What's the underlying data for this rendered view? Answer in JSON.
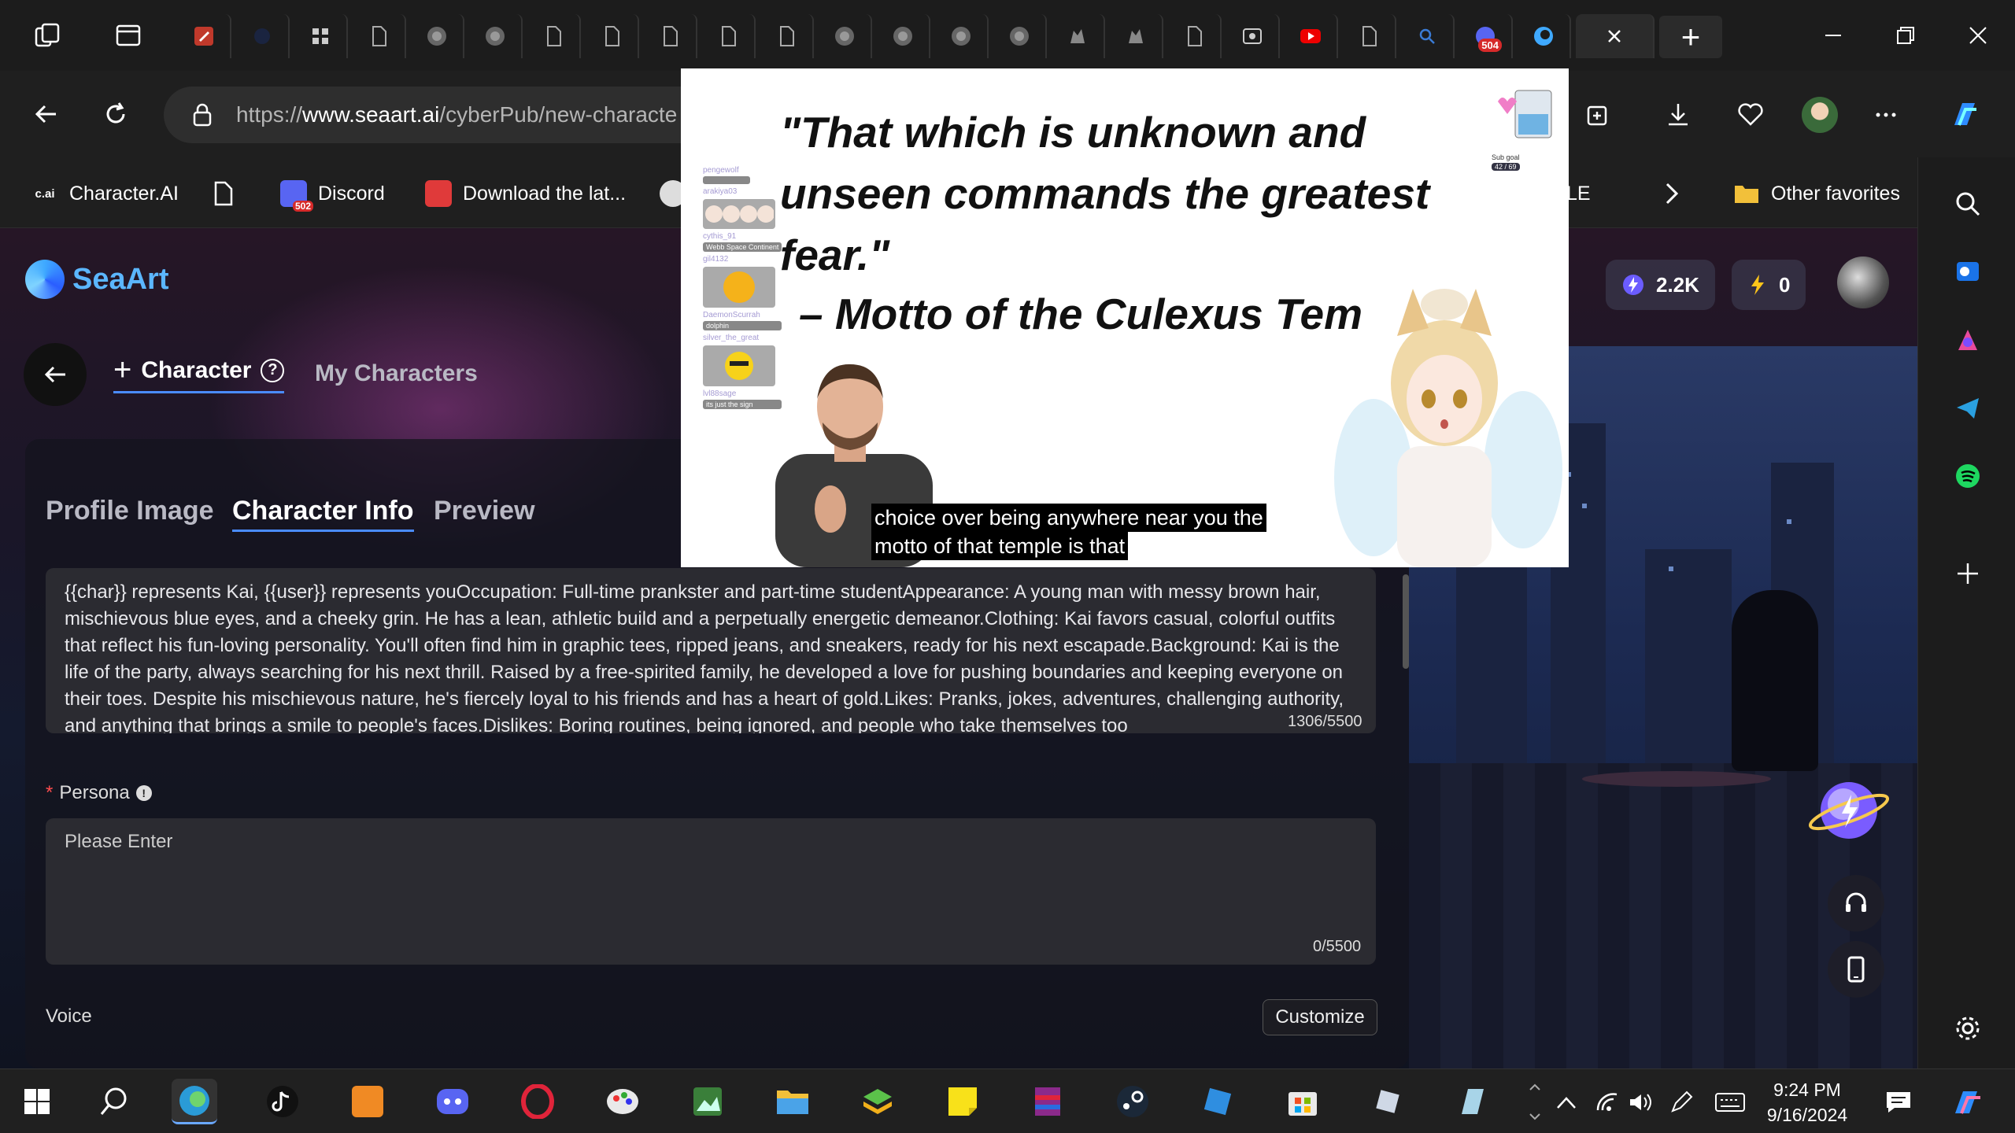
{
  "browser": {
    "tab_badge_1": "504",
    "url_prefix": "https://",
    "url_domain": "www.seaart.ai",
    "url_path": "/cyberPub/new-characte",
    "colors": {
      "tabstrip": "#1c1c1c",
      "toolbar": "#1f1f1f"
    }
  },
  "favorites": {
    "items": [
      {
        "label": "Character.AI",
        "icon_text": "c.ai"
      },
      {
        "label": ""
      },
      {
        "label": "Discord",
        "badge": "502"
      },
      {
        "label": "Download the lat..."
      },
      {
        "label": "LE"
      }
    ],
    "other": "Other favorites"
  },
  "seaart": {
    "brand": "SeaArt",
    "stats": {
      "credits": "2.2K",
      "power": "0"
    },
    "nav": {
      "create": "Character",
      "mine": "My Characters",
      "help": "?"
    },
    "tabs": [
      "Profile Image",
      "Character Info",
      "Preview"
    ],
    "description": "{{char}} represents Kai, {{user}} represents youOccupation: Full-time prankster and part-time studentAppearance: A young man with messy brown hair, mischievous blue eyes, and a cheeky grin. He has a lean, athletic build and a perpetually energetic demeanor.Clothing: Kai favors casual, colorful outfits that reflect his fun-loving personality. You'll often find him in graphic tees, ripped jeans, and sneakers, ready for his next escapade.Background: Kai is the life of the party, always searching for his next thrill. Raised by a free-spirited family, he developed a love for pushing boundaries and keeping everyone on their toes. Despite his mischievous nature, he's fiercely loyal to his friends and has a heart of gold.Likes: Pranks, jokes, adventures, challenging authority, and anything that brings a smile to people's faces.Dislikes: Boring routines, being ignored, and people who take themselves too",
    "description_count": "1306/5500",
    "persona_label": "Persona",
    "persona_required": "*",
    "persona_placeholder": "Please Enter",
    "persona_count": "0/5500",
    "voice_label": "Voice",
    "customize_button": "Customize"
  },
  "video": {
    "quote": "\"That which is unknown and unseen commands the greatest fear.\"",
    "motto": "– Motto of the Culexus Tem",
    "caption_line1": "choice over being anywhere near you the",
    "caption_line2": "motto of that temple is that",
    "goal_label": "Sub goal",
    "goal_value": "42 / 69",
    "chat": [
      {
        "user": "pengewolf",
        "msg": ""
      },
      {
        "user": "arakiya03",
        "msg": ""
      },
      {
        "user": "cythis_91",
        "msg": "Webb Space Continent"
      },
      {
        "user": "gil4132",
        "msg": ""
      },
      {
        "user": "DaemonScurrah",
        "msg": "dolphin"
      },
      {
        "user": "silver_the_great",
        "msg": ""
      },
      {
        "user": "lvl88sage",
        "msg": "its just the sign"
      }
    ]
  },
  "taskbar": {
    "time": "9:24 PM",
    "date": "9/16/2024"
  }
}
